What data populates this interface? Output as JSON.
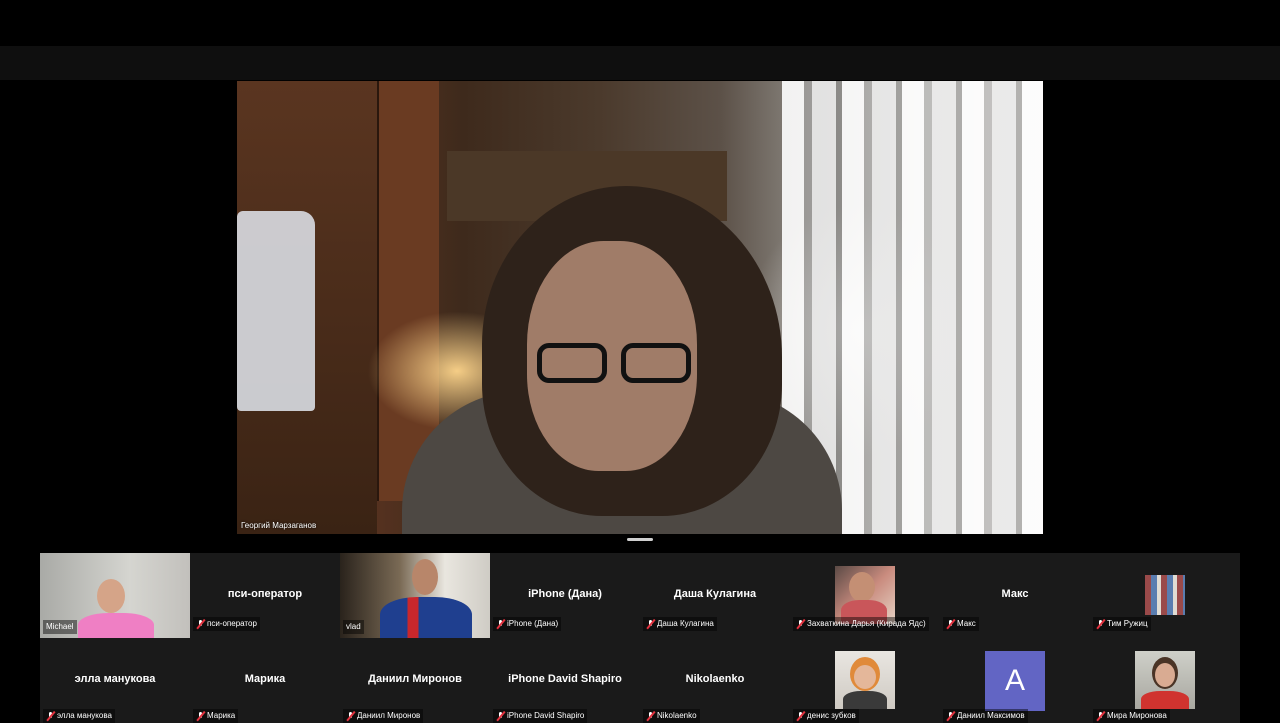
{
  "speaker": {
    "name": "Георгий Марзаганов"
  },
  "participants_row1": [
    {
      "name": "Michael",
      "center": "",
      "video": true,
      "muted": false
    },
    {
      "name": "пси-оператор",
      "center": "пси-оператор",
      "video": false,
      "muted": true
    },
    {
      "name": "vlad",
      "center": "",
      "video": true,
      "muted": false
    },
    {
      "name": "iPhone (Дана)",
      "center": "iPhone (Дана)",
      "video": false,
      "muted": true
    },
    {
      "name": "Даша Кулагина",
      "center": "Даша Кулагина",
      "video": false,
      "muted": true
    },
    {
      "name": "Захваткина Дарья (Кирада Ядс)",
      "center": "",
      "video": false,
      "muted": true
    },
    {
      "name": "Макс",
      "center": "Макс",
      "video": false,
      "muted": true
    },
    {
      "name": "Тим Ружиц",
      "center": "",
      "video": false,
      "muted": true
    }
  ],
  "participants_row2": [
    {
      "name": "элла манукова",
      "center": "элла манукова",
      "muted": true
    },
    {
      "name": "Марика",
      "center": "Марика",
      "muted": true
    },
    {
      "name": "Даниил Миронов",
      "center": "Даниил Миронов",
      "muted": true
    },
    {
      "name": "iPhone David Shapiro",
      "center": "iPhone David Shapiro",
      "muted": true
    },
    {
      "name": "Nikolaenko",
      "center": "Nikolaenko",
      "muted": true
    },
    {
      "name": "денис зубков",
      "center": "",
      "muted": true
    },
    {
      "name": "Даниил Максимов",
      "center": "",
      "avatar_letter": "A",
      "muted": true
    },
    {
      "name": "Мира Миронова",
      "center": "",
      "muted": true
    }
  ],
  "colors": {
    "muted_icon": "#e2323f",
    "avatar_bg": "#6265c4",
    "tile_bg": "#1a1a1a"
  }
}
